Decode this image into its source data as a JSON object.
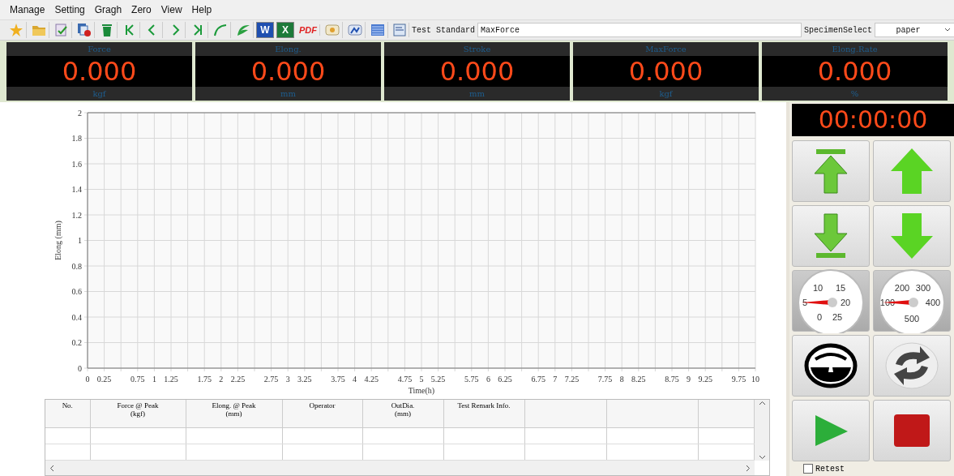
{
  "menu": [
    "Manage",
    "Setting",
    "Gragh",
    "Zero",
    "View",
    "Help"
  ],
  "toolbar": [
    {
      "kind": "star"
    },
    {
      "kind": "folder"
    },
    {
      "kind": "checklist"
    },
    {
      "kind": "copy-delete"
    },
    {
      "kind": "trash"
    },
    {
      "kind": "first"
    },
    {
      "kind": "prev"
    },
    {
      "kind": "next"
    },
    {
      "kind": "last"
    },
    {
      "kind": "curve"
    },
    {
      "kind": "leaf"
    },
    {
      "kind": "letter",
      "text": "W",
      "color": "#1f4fb0"
    },
    {
      "kind": "letter",
      "text": "X",
      "color": "#1d7a3a"
    },
    {
      "kind": "pdf",
      "text": "PDF"
    },
    {
      "kind": "image"
    },
    {
      "kind": "chart"
    },
    {
      "kind": "list"
    }
  ],
  "test_standard": {
    "label": "Test Standard",
    "value": "MaxForce"
  },
  "specimen_select": {
    "label": "SpecimenSelect",
    "value": "paper"
  },
  "readouts": [
    {
      "label": "Force",
      "value": "0.000",
      "unit": "kgf"
    },
    {
      "label": "Elong.",
      "value": "0.000",
      "unit": "mm"
    },
    {
      "label": "Stroke",
      "value": "0.000",
      "unit": "mm"
    },
    {
      "label": "MaxForce",
      "value": "0.000",
      "unit": "kgf"
    },
    {
      "label": "Elong.Rate",
      "value": "0.000",
      "unit": "%"
    }
  ],
  "chart": {
    "chart_data": {
      "type": "line",
      "xlabel": "Time(h)",
      "ylabel": "Elong (mm)",
      "grid": true,
      "xlim": [
        0,
        10
      ],
      "ylim": [
        0,
        2
      ],
      "xticks": [
        0,
        0.25,
        0.75,
        1,
        1.25,
        1.75,
        2,
        2.25,
        2.75,
        3,
        3.25,
        3.75,
        4,
        4.25,
        4.75,
        5,
        5.25,
        5.75,
        6,
        6.25,
        6.75,
        7,
        7.25,
        7.75,
        8,
        8.25,
        8.75,
        9,
        9.25,
        9.75,
        10
      ],
      "yticks": [
        0,
        0.2,
        0.4,
        0.6,
        0.8,
        1,
        1.2,
        1.4,
        1.6,
        1.8,
        2
      ]
    }
  },
  "table": {
    "columns": [
      "No.",
      "Force @ Peak\n(kgf)",
      "Elong. @ Peak\n(mm)",
      "Operator",
      "OutDia.\n(mm)",
      "Test Remark Info."
    ]
  },
  "timer": "00:00:00",
  "controls": [
    {
      "kind": "top"
    },
    {
      "kind": "up"
    },
    {
      "kind": "bottom"
    },
    {
      "kind": "down"
    },
    {
      "kind": "dial",
      "labels": [
        "10",
        "15",
        "5",
        "20",
        "0",
        "25"
      ],
      "level": 0.2
    },
    {
      "kind": "dial",
      "labels": [
        "200",
        "300",
        "100",
        "400",
        "500"
      ],
      "level": 0.2
    },
    {
      "kind": "meter"
    },
    {
      "kind": "refresh"
    },
    {
      "kind": "start"
    },
    {
      "kind": "stop"
    }
  ],
  "retest": {
    "label": "Retest",
    "checked": false
  }
}
